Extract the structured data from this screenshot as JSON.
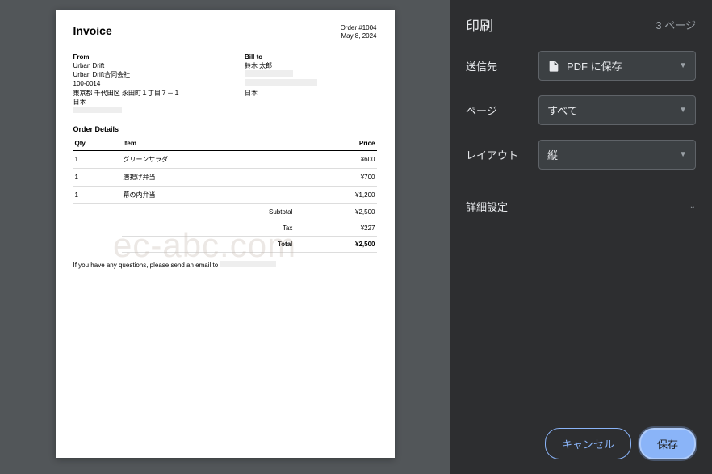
{
  "invoice": {
    "title": "Invoice",
    "order_label": "Order #1004",
    "date": "May 8, 2024",
    "from_label": "From",
    "from_name": "Urban Drift",
    "from_company": "Urban Drift合同会社",
    "from_zip": "100-0014",
    "from_addr": "東京都 千代田区 永田町１丁目７－１",
    "from_country": "日本",
    "bill_label": "Bill to",
    "bill_name": "鈴木 太郎",
    "bill_country": "日本",
    "details_label": "Order Details",
    "cols": {
      "qty": "Qty",
      "item": "Item",
      "price": "Price"
    },
    "items": [
      {
        "qty": "1",
        "name": "グリーンサラダ",
        "price": "¥600"
      },
      {
        "qty": "1",
        "name": "唐揚げ弁当",
        "price": "¥700"
      },
      {
        "qty": "1",
        "name": "幕の内弁当",
        "price": "¥1,200"
      }
    ],
    "subtotal_label": "Subtotal",
    "subtotal": "¥2,500",
    "tax_label": "Tax",
    "tax": "¥227",
    "total_label": "Total",
    "total": "¥2,500",
    "footer_text": "If you have any questions, please send an email to"
  },
  "watermark": "ec-abc.com",
  "print": {
    "title": "印刷",
    "page_count": "3 ページ",
    "dest_label": "送信先",
    "dest_value": "PDF に保存",
    "pages_label": "ページ",
    "pages_value": "すべて",
    "layout_label": "レイアウト",
    "layout_value": "縦",
    "advanced": "詳細設定",
    "cancel": "キャンセル",
    "save": "保存"
  }
}
